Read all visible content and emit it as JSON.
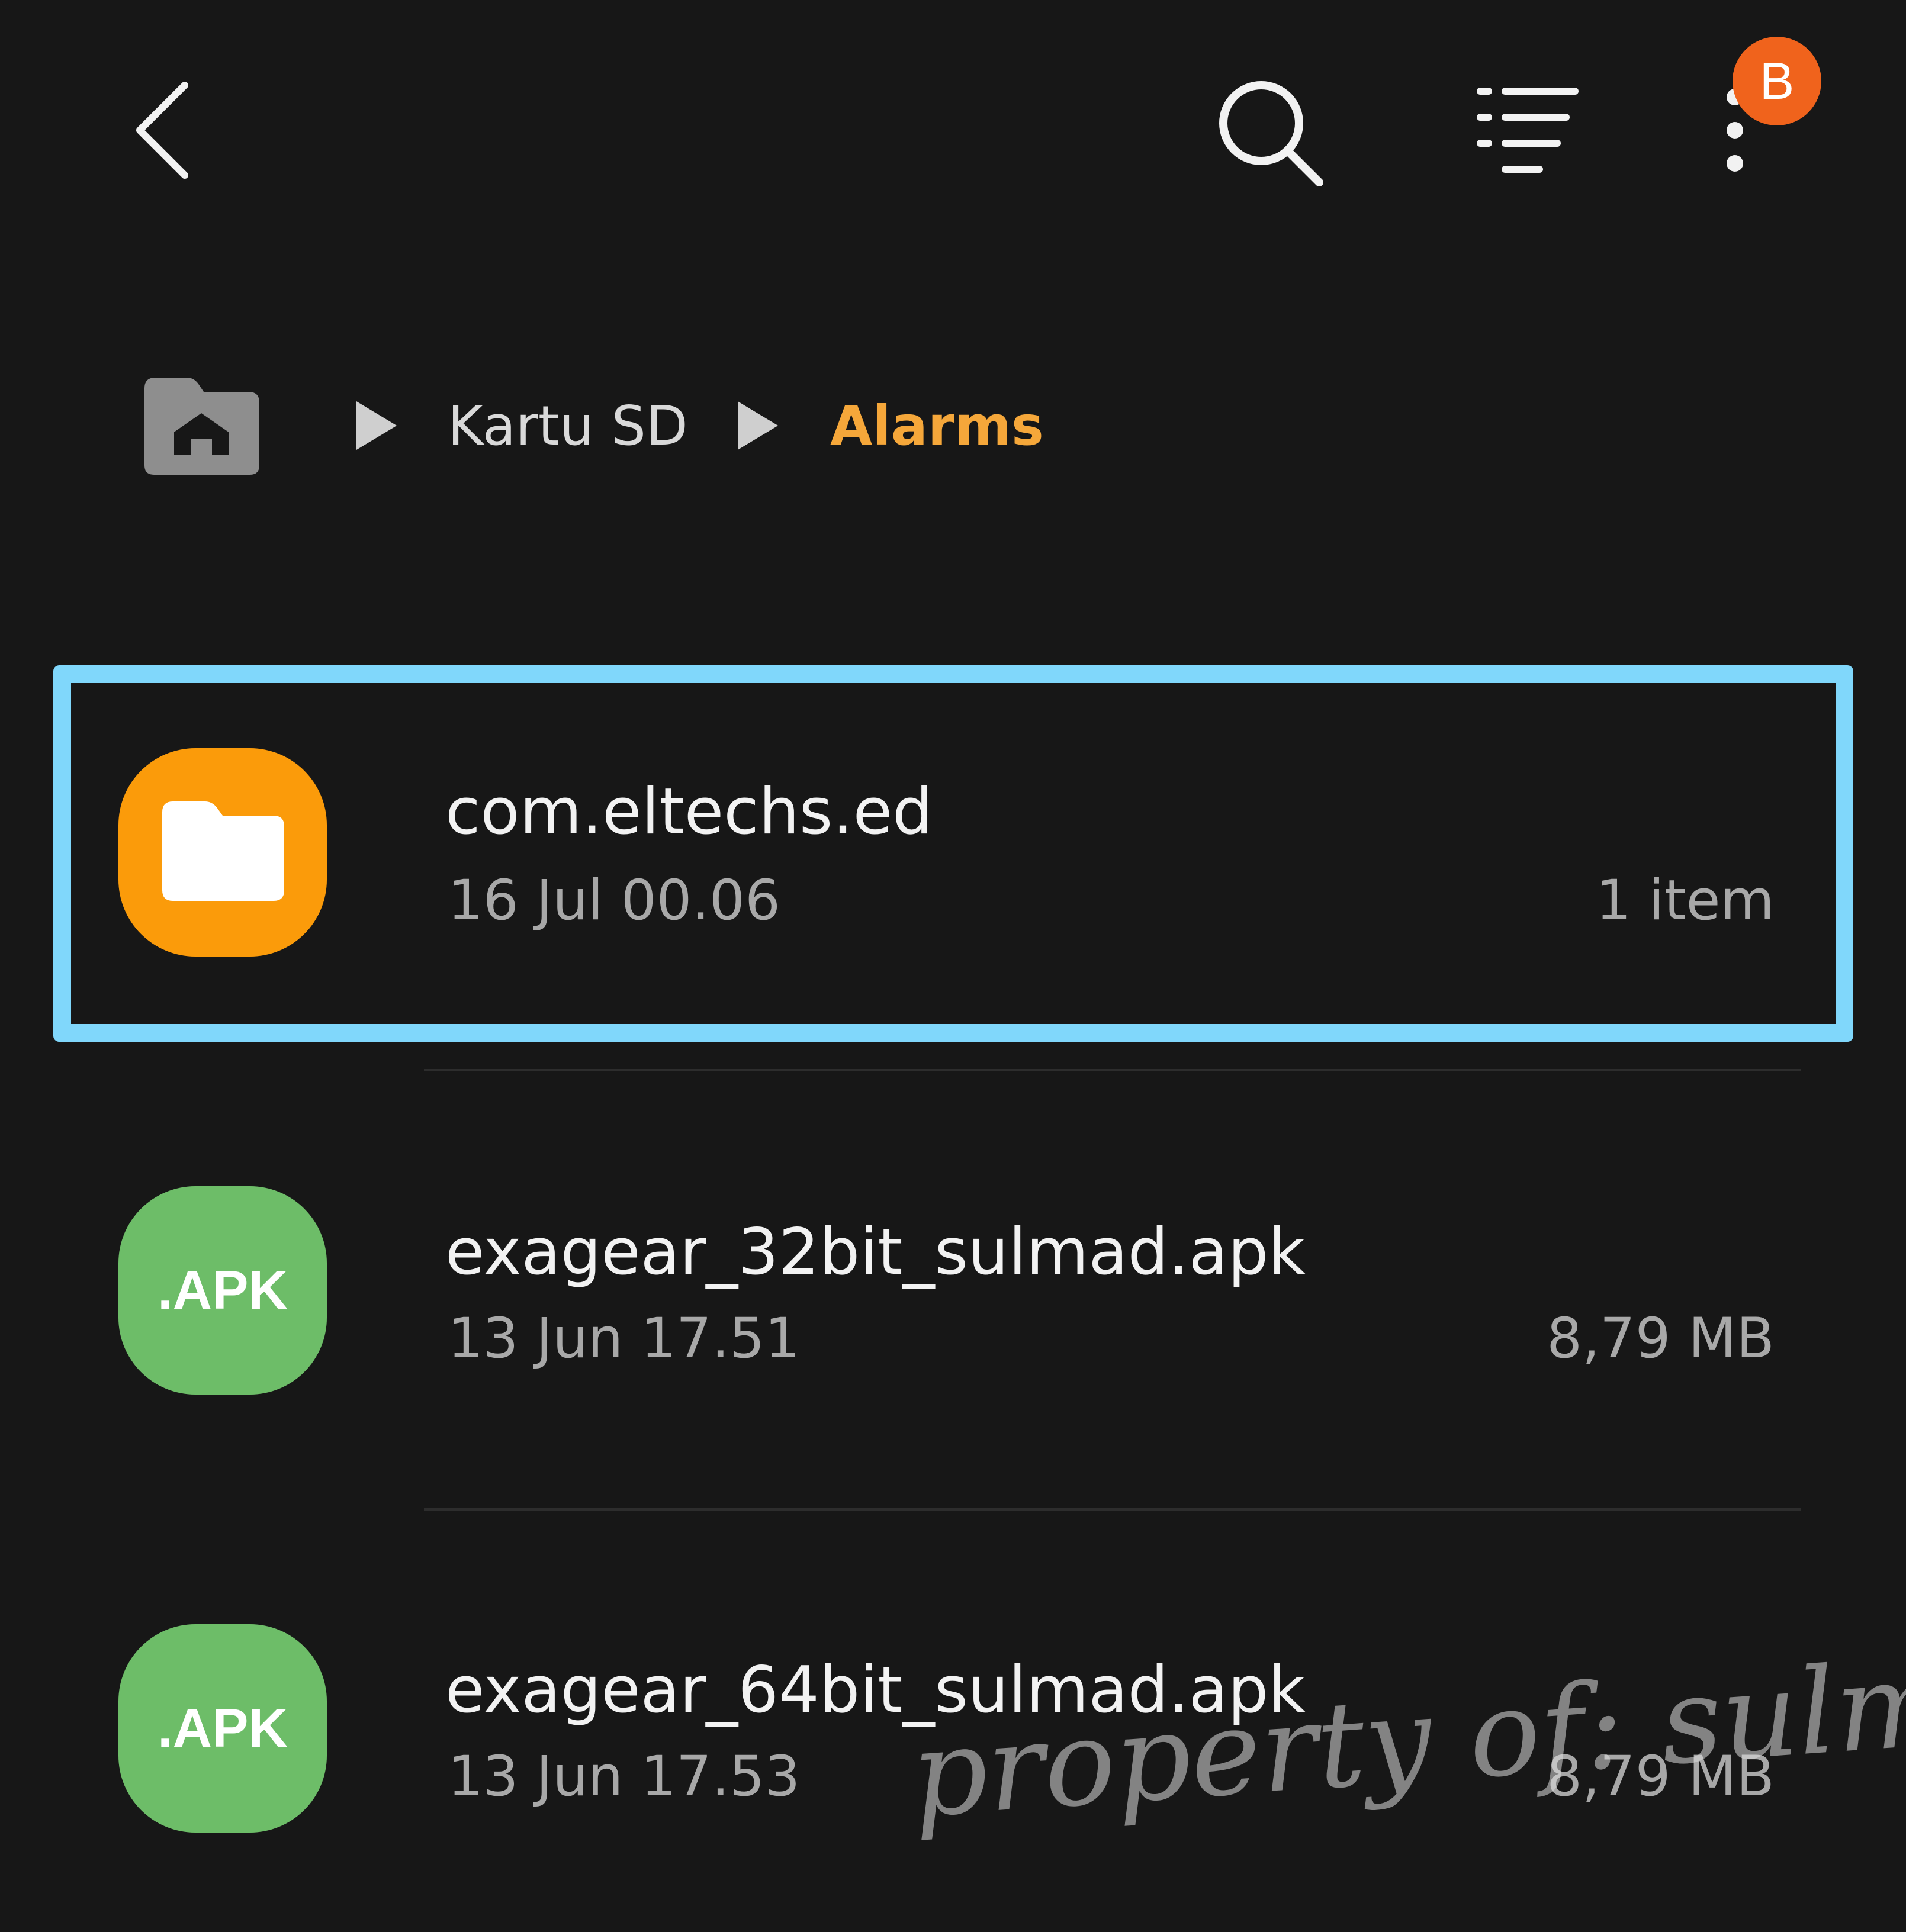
{
  "toolbar": {
    "back_icon": "chevron-left-icon",
    "search_icon": "search-icon",
    "sort_icon": "sort-lines-icon",
    "more_icon": "more-vertical-icon",
    "badge_label": "B"
  },
  "breadcrumb": {
    "home_icon": "home-folder-icon",
    "items": [
      {
        "label": "Kartu SD"
      },
      {
        "label": "Alarms"
      }
    ]
  },
  "files": [
    {
      "name": "com.eltechs.ed",
      "date": "16 Jul 00.06",
      "meta": "1 item",
      "type": "folder",
      "selected": true
    },
    {
      "name": "exagear_32bit_sulmad.apk",
      "date": "13 Jun 17.51",
      "meta": "8,79 MB",
      "type": "apk",
      "icon_label": ".APK"
    },
    {
      "name": "exagear_64bit_sulmad.apk",
      "date": "13 Jun 17.53",
      "meta": "8,79 MB",
      "type": "apk",
      "icon_label": ".APK"
    }
  ],
  "watermark": "property of: sulmad",
  "colors": {
    "background": "#171717",
    "accent_breadcrumb": "#f5a73a",
    "folder_icon": "#fb9b0a",
    "apk_icon": "#6dbd68",
    "badge": "#f0631c",
    "selection_border": "#80d7fb"
  }
}
